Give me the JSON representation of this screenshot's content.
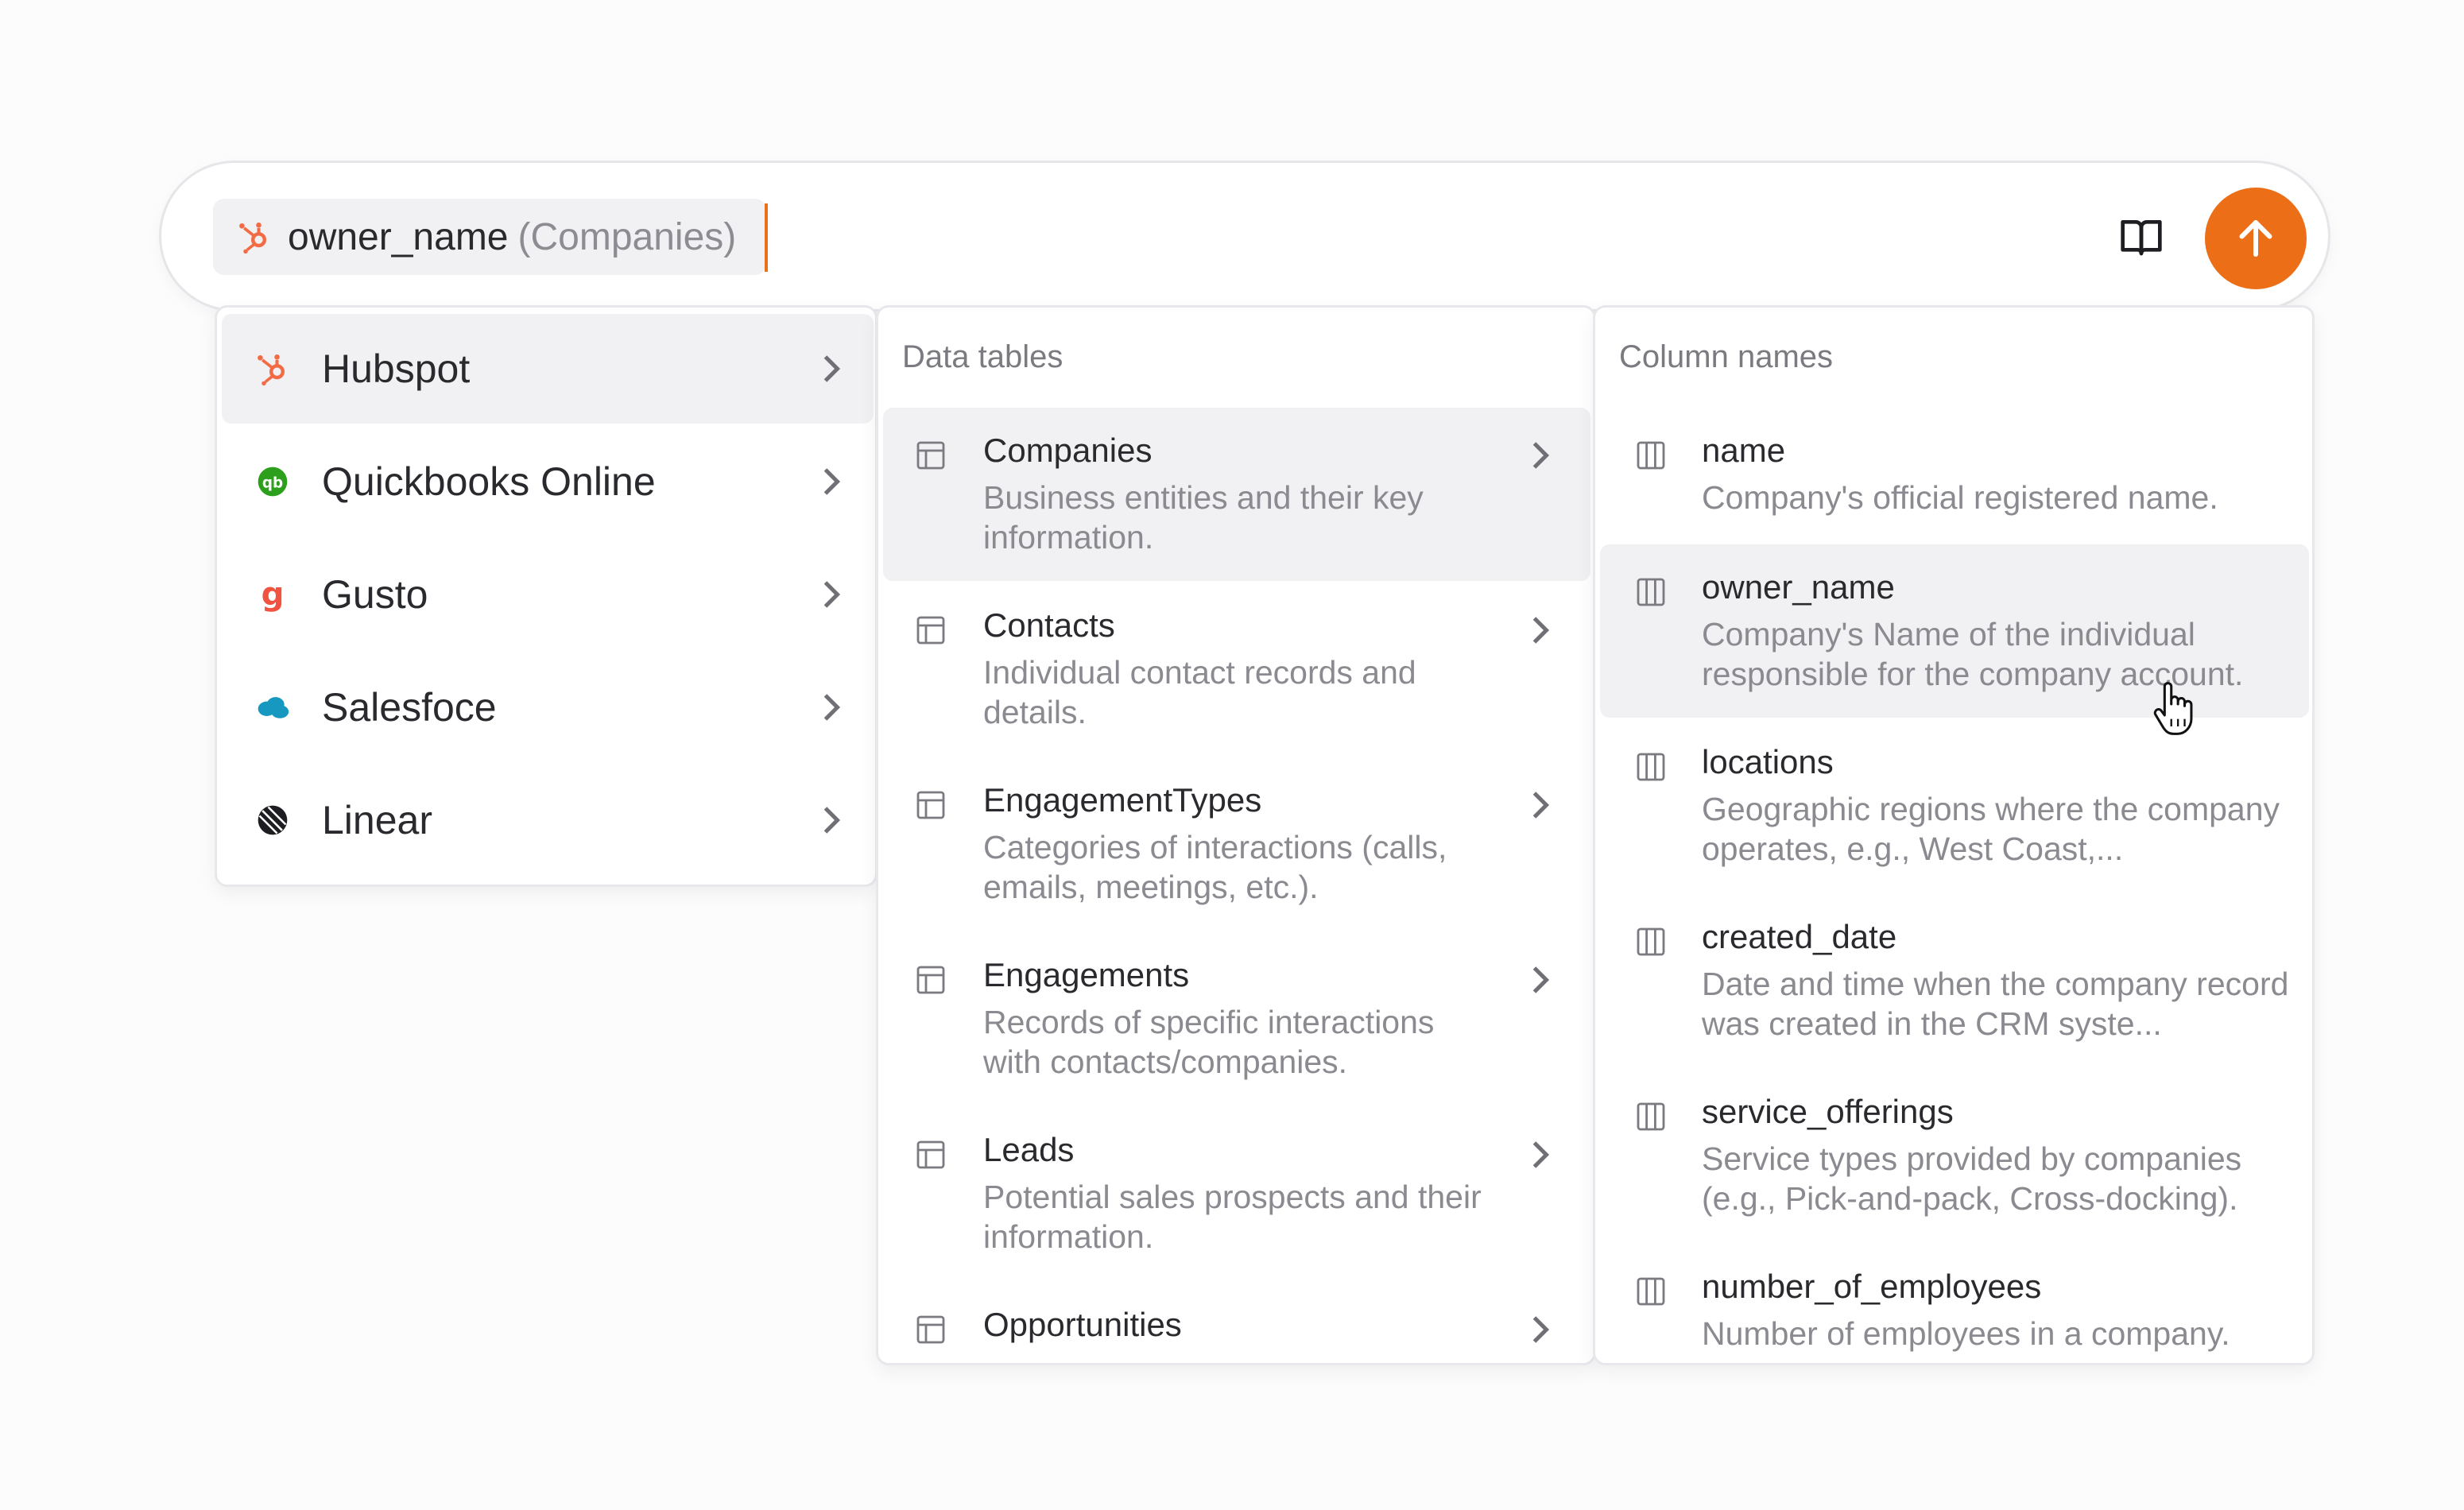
{
  "composer": {
    "chip_name": "owner_name",
    "chip_table": "(Companies)",
    "colors": {
      "accent": "#ec6f17",
      "hubspot": "#f26b45"
    }
  },
  "sources": {
    "items": [
      {
        "label": "Hubspot",
        "icon": "hubspot-icon",
        "active": true
      },
      {
        "label": "Quickbooks Online",
        "icon": "quickbooks-icon"
      },
      {
        "label": "Gusto",
        "icon": "gusto-icon"
      },
      {
        "label": "Salesfoce",
        "icon": "salesforce-icon"
      },
      {
        "label": "Linear",
        "icon": "linear-icon"
      }
    ]
  },
  "tables": {
    "heading": "Data tables",
    "items": [
      {
        "name": "Companies",
        "desc": "Business entities and their key information.",
        "active": true
      },
      {
        "name": "Contacts",
        "desc": "Individual contact records and details."
      },
      {
        "name": "EngagementTypes",
        "desc": "Categories of interactions (calls, emails, meetings, etc.)."
      },
      {
        "name": "Engagements",
        "desc": "Records of specific interactions with contacts/companies."
      },
      {
        "name": "Leads",
        "desc": "Potential sales prospects and their information."
      },
      {
        "name": "Opportunities",
        "desc": ""
      }
    ]
  },
  "columns": {
    "heading": "Column names",
    "items": [
      {
        "name": "name",
        "desc": "Company's official registered name."
      },
      {
        "name": "owner_name",
        "desc": "Company's Name of the individual responsible for the company account.",
        "active": true
      },
      {
        "name": "locations",
        "desc": "Geographic regions where the company operates, e.g., West Coast,..."
      },
      {
        "name": "created_date",
        "desc": "Date and time when the company record was created in the CRM syste..."
      },
      {
        "name": "service_offerings",
        "desc": "Service types provided by companies (e.g., Pick-and-pack, Cross-docking)."
      },
      {
        "name": "number_of_employees",
        "desc": "Number of employees in a company."
      }
    ]
  }
}
